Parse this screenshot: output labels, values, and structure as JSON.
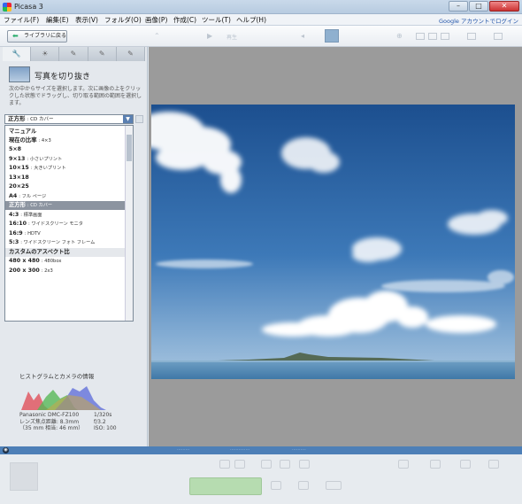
{
  "window": {
    "title": "Picasa 3",
    "min": "–",
    "max": "□",
    "close": "✕"
  },
  "menu": [
    "ファイル(F)",
    "編集(E)",
    "表示(V)",
    "フォルダ(O)",
    "画像(P)",
    "作成(C)",
    "ツール(T)",
    "ヘルプ(H)"
  ],
  "account_link": "Google アカウントでログイン",
  "toolbar": {
    "back_label": "ライブラリに戻る",
    "play_label": "再生"
  },
  "tabs": [
    "wrench",
    "brush",
    "pencil",
    "pencil",
    "pencil"
  ],
  "crop": {
    "title": "写真を切り抜き",
    "description": "次の中からサイズを選択します。次に画像の上をクリックした状態でドラッグし、切り取る範囲の範囲を選択します。"
  },
  "size_select": {
    "value_main": "正方形",
    "value_sub": ": CD カバー"
  },
  "size_options": [
    {
      "main": "マニュアル",
      "sub": ""
    },
    {
      "main": "現在の比率",
      "sub": ": 4×3"
    },
    {
      "main": "5×8",
      "sub": ""
    },
    {
      "main": "9×13",
      "sub": ": 小さいプリント"
    },
    {
      "main": "10×15",
      "sub": ": 大きいプリント"
    },
    {
      "main": "13×18",
      "sub": ""
    },
    {
      "main": "20×25",
      "sub": ""
    },
    {
      "main": "A4",
      "sub": ": フル ページ"
    },
    {
      "main": "正方形",
      "sub": ": CD カバー",
      "selected": true
    },
    {
      "main": "4:3",
      "sub": ": 標準画面"
    },
    {
      "main": "16:10",
      "sub": ": ワイドスクリーン モニタ"
    },
    {
      "main": "16:9",
      "sub": ": HDTV"
    },
    {
      "main": "5:3",
      "sub": ": ワイドスクリーン フォト フレーム"
    },
    {
      "main": "カスタムのアスペクト比",
      "sub": "",
      "header": true
    },
    {
      "main": "480 x 480",
      "sub": ": 480box"
    },
    {
      "main": "200 x 300",
      "sub": ": 2x3"
    }
  ],
  "histogram": {
    "title": "ヒストグラムとカメラの情報",
    "camera": "Panasonic DMC-FZ100",
    "focal": "レンズ焦点距離: 8.3mm",
    "equiv": "（35 mm 相当: 46 mm）",
    "shutter": "1/320s",
    "aperture": "f/3.2",
    "iso": "ISO: 100"
  },
  "colors": {
    "accent": "#4d7fb7",
    "selected_row": "#8c94a0",
    "viewer_bg": "#9b9b9b"
  }
}
